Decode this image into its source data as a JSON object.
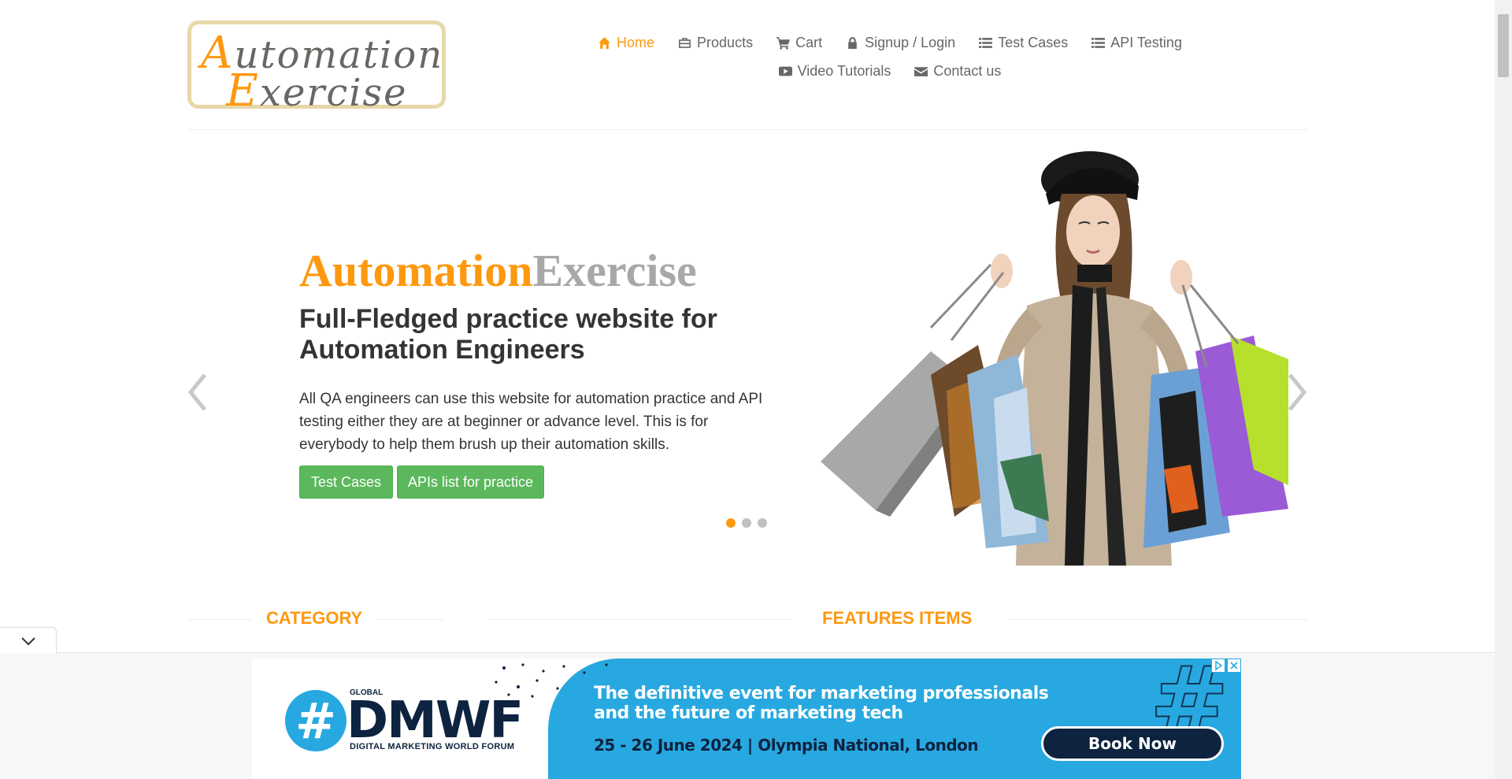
{
  "logo": {
    "line1_cap": "A",
    "line1_rest": "utomation",
    "line2_cap": "E",
    "line2_rest": "xercise"
  },
  "nav": {
    "items": [
      {
        "label": "Home",
        "icon": "home-icon",
        "active": true
      },
      {
        "label": "Products",
        "icon": "briefcase-icon"
      },
      {
        "label": "Cart",
        "icon": "cart-icon"
      },
      {
        "label": "Signup / Login",
        "icon": "lock-icon"
      },
      {
        "label": "Test Cases",
        "icon": "list-icon"
      },
      {
        "label": "API Testing",
        "icon": "list-icon"
      },
      {
        "label": "Video Tutorials",
        "icon": "youtube-play-icon"
      },
      {
        "label": "Contact us",
        "icon": "envelope-icon"
      }
    ]
  },
  "slider": {
    "brand_part1": "Automation",
    "brand_part2": "Exercise",
    "headline": "Full-Fledged practice website for Automation Engineers",
    "description": "All QA engineers can use this website for automation practice and API testing either they are at beginner or advance level. This is for everybody to help them brush up their automation skills.",
    "button_test_cases": "Test Cases",
    "button_apis": "APIs list for practice",
    "active_slide": 1,
    "slide_count": 3
  },
  "sections": {
    "category": "CATEGORY",
    "features": "FEATURES ITEMS"
  },
  "ad": {
    "global": "GLOBAL",
    "hash": "#",
    "brand": "DMWF",
    "subtitle": "DIGITAL MARKETING WORLD FORUM",
    "headline": "The definitive event for marketing professionals and the future of marketing tech",
    "date": "25 - 26 June 2024  |  Olympia National, London",
    "cta": "Book Now"
  },
  "colors": {
    "accent": "#fe980f",
    "button_green": "#5cb85c",
    "ad_blue": "#28a8e0",
    "ad_navy": "#0d2340"
  }
}
